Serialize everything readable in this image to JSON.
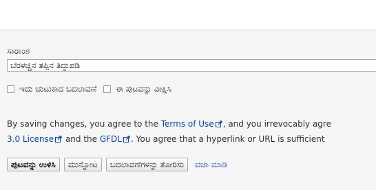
{
  "summary": {
    "label": "ಸಾರಾಂಶ",
    "value": "ಬೆರಳಚ್ಚಿನ ತಪ್ಪಿನ ತಿದ್ದುಪಡಿ"
  },
  "options": {
    "minor_edit_label": "ಇದು ಚುಟುಕಾದ ಬದಲಾವಣೆ",
    "watch_page_label": "ಈ ಪುಟವನ್ನು ವೀಕ್ಷಿಸಿ",
    "minor_edit_checked": false,
    "watch_page_checked": false
  },
  "legal": {
    "line1_start": "By saving changes, you agree to the ",
    "terms_link": "Terms of Use",
    "line1_end": ", and you irrevocably agre",
    "license_link": "3.0 License",
    "line2_mid": " and the ",
    "gfdl_link": "GFDL",
    "line2_end": ". You agree that a hyperlink or URL is sufficient"
  },
  "buttons": {
    "save": "ಪುಟವನ್ನು ಉಳಿಸಿ",
    "preview": "ಮುನ್ನೋಟ",
    "show_changes": "ಬದಲಾವಣೆಗಳನ್ನು ತೋರಿಸು",
    "cancel": "ವಜಾ ಮಾಡಿ"
  },
  "colors": {
    "link": "#0645ad",
    "background": "#f6f6f6"
  },
  "icons": {
    "external_link": "external-link-icon"
  }
}
